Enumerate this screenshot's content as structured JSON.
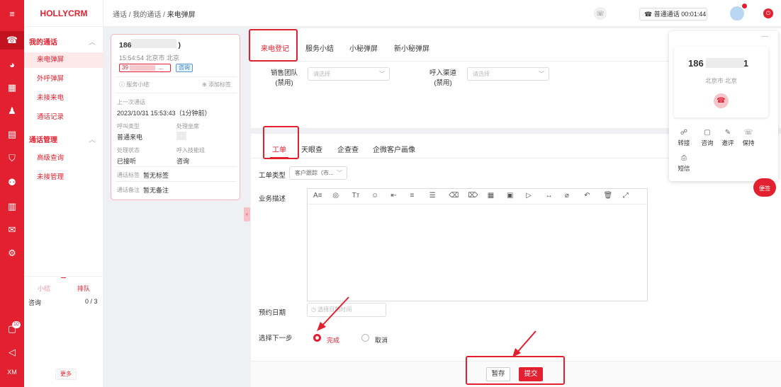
{
  "app": {
    "logo": "HOLLYCRM"
  },
  "breadcrumb": [
    "通话",
    "我的通话",
    "来电弹屏"
  ],
  "topbar": {
    "call_status": "☎ 普通通话 00:01:44",
    "call_icon": "phone-icon",
    "power_icon": "power-icon"
  },
  "rail": {
    "icons": [
      "menu-icon",
      "phone-icon",
      "chat-icon",
      "grid-icon",
      "person-icon",
      "document-icon",
      "shield-icon",
      "robot-icon",
      "chart-icon",
      "message-icon",
      "gear-icon"
    ],
    "bottom_badge": "10",
    "bottom_label": "XM"
  },
  "sidebar": {
    "groups": [
      {
        "title": "我的通话",
        "items": [
          "来电弹屏",
          "外呼弹屏",
          "未接来电",
          "通话记录"
        ]
      },
      {
        "title": "通话管理",
        "items": [
          "高级查询",
          "未接管理"
        ]
      }
    ],
    "footer": {
      "tab1": "小结",
      "tab2": "排队",
      "row_label": "咨询",
      "row_value": "0 / 3",
      "more": "更多"
    }
  },
  "call_card": {
    "number": "186",
    "number_suffix": ")",
    "meta": "15:54:54 北京市 北京",
    "tag1": "39",
    "tag1_suffix": "...",
    "tag2": "咨询",
    "summary_link": "服务小结",
    "add_tag": "添加标签",
    "last_call_label": "上一次通话",
    "last_call_value": "2023/10/31 15:53:43（1分钟前）",
    "call_type_label": "呼叫类型",
    "call_type_value": "普通来电",
    "handler_label": "处理坐席",
    "handler_value": "",
    "process_label": "处理状态",
    "process_value": "已接听",
    "skill_label": "呼入技能组",
    "skill_value": "咨询",
    "call_tag_label": "通话标签",
    "call_tag_value": "暂无标签",
    "call_note_label": "通话备注",
    "call_note_value": "暂无备注"
  },
  "panel1": {
    "tabs": [
      "来电登记",
      "服务小结",
      "小秘弹屏",
      "新小秘弹屏"
    ],
    "sales_team_label": "销售团队\n(禁用)",
    "sales_team_placeholder": "请选择",
    "channel_label": "呼入渠道\n(禁用)",
    "channel_placeholder": "请选择"
  },
  "panel2": {
    "tabs": [
      "工单",
      "天眼查",
      "企查查",
      "企微客户画像"
    ],
    "ticket_type_label": "工单类型",
    "ticket_type_value": "客户跟踪（市...",
    "desc_label": "业务描述",
    "toolbar_icons": [
      "A≡",
      "◎",
      "Tт",
      "☺",
      "⇤",
      "≡",
      "☰",
      "⌫",
      "⌦",
      "▦",
      "▣",
      "▷",
      "↔",
      "⌀",
      "↶",
      "🗑",
      "⤢"
    ],
    "date_label": "预约日期",
    "date_placeholder": "◷ 选择日期时间",
    "next_step_label": "选择下一步",
    "opt_done": "完成",
    "opt_cancel": "取消",
    "btn_save": "暂存",
    "btn_submit": "提交"
  },
  "float_panel": {
    "number": "186",
    "number_suffix": "1",
    "location": "北京市 北京",
    "actions": [
      {
        "icon": "☍",
        "label": "转接"
      },
      {
        "icon": "▢",
        "label": "咨询"
      },
      {
        "icon": "✎",
        "label": "邀评"
      },
      {
        "icon": "☏",
        "label": "保持"
      },
      {
        "icon": "⎙",
        "label": "短信"
      }
    ]
  },
  "memo": {
    "label": "便签"
  }
}
